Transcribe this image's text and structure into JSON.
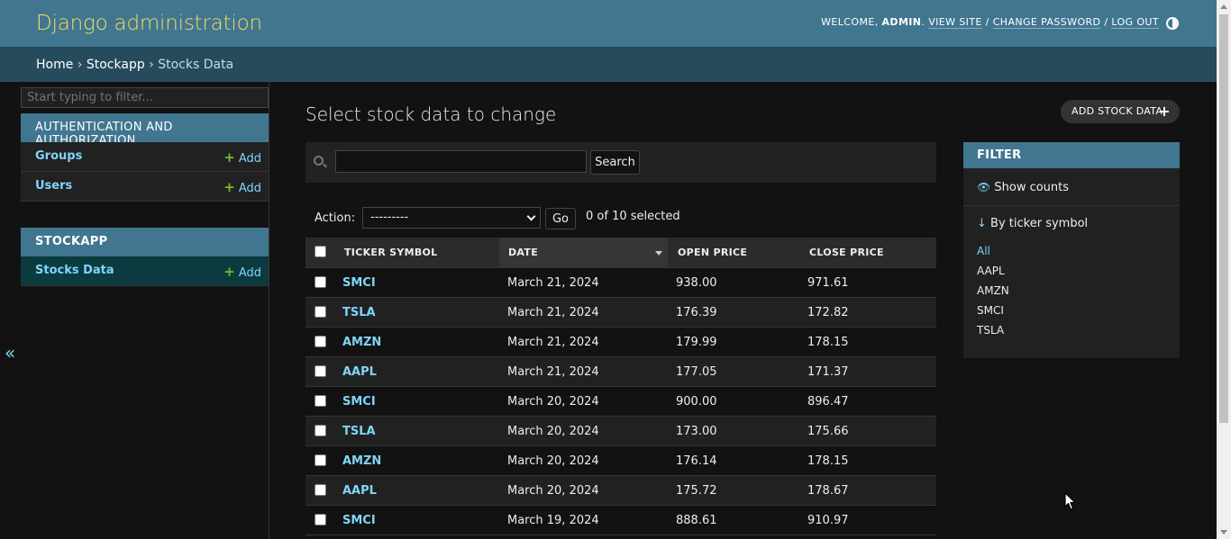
{
  "header": {
    "site_name": "Django administration",
    "welcome": "WELCOME,",
    "username": "ADMIN",
    "view_site": "VIEW SITE",
    "change_password": "CHANGE PASSWORD",
    "log_out": "LOG OUT",
    "theme_icon": "theme-toggle-icon"
  },
  "breadcrumbs": {
    "home": "Home",
    "app": "Stockapp",
    "current": "Stocks Data",
    "separator": "›"
  },
  "sidebar": {
    "filter_placeholder": "Start typing to filter...",
    "apps": [
      {
        "name": "AUTHENTICATION AND AUTHORIZATION",
        "models": [
          {
            "name": "Groups",
            "add": "Add"
          },
          {
            "name": "Users",
            "add": "Add"
          }
        ]
      },
      {
        "name": "STOCKAPP",
        "models": [
          {
            "name": "Stocks Data",
            "add": "Add"
          }
        ]
      }
    ],
    "collapse": "«"
  },
  "content": {
    "title": "Select stock data to change",
    "add_button": "ADD STOCK DATA",
    "search_button": "Search",
    "search_value": "",
    "action_label": "Action:",
    "action_selected": "---------",
    "go_button": "Go",
    "selected_counter": "0 of 10 selected"
  },
  "table": {
    "columns": [
      "TICKER SYMBOL",
      "DATE",
      "OPEN PRICE",
      "CLOSE PRICE"
    ],
    "sorted_column": "DATE",
    "rows": [
      {
        "ticker": "SMCI",
        "date": "March 21, 2024",
        "open": "938.00",
        "close": "971.61"
      },
      {
        "ticker": "TSLA",
        "date": "March 21, 2024",
        "open": "176.39",
        "close": "172.82"
      },
      {
        "ticker": "AMZN",
        "date": "March 21, 2024",
        "open": "179.99",
        "close": "178.15"
      },
      {
        "ticker": "AAPL",
        "date": "March 21, 2024",
        "open": "177.05",
        "close": "171.37"
      },
      {
        "ticker": "SMCI",
        "date": "March 20, 2024",
        "open": "900.00",
        "close": "896.47"
      },
      {
        "ticker": "TSLA",
        "date": "March 20, 2024",
        "open": "173.00",
        "close": "175.66"
      },
      {
        "ticker": "AMZN",
        "date": "March 20, 2024",
        "open": "176.14",
        "close": "178.15"
      },
      {
        "ticker": "AAPL",
        "date": "March 20, 2024",
        "open": "175.72",
        "close": "178.67"
      },
      {
        "ticker": "SMCI",
        "date": "March 19, 2024",
        "open": "888.61",
        "close": "910.97"
      }
    ]
  },
  "filter": {
    "title": "FILTER",
    "show_counts": "Show counts",
    "heading": "By ticker symbol",
    "arrow": "↓",
    "choices": [
      "All",
      "AAPL",
      "AMZN",
      "SMCI",
      "TSLA"
    ],
    "selected": "All"
  },
  "colors": {
    "header": "#417690",
    "breadcrumbs": "#264b5d",
    "brand_text": "#f5dd5d",
    "link": "#81d4fa",
    "add_plus": "#70bf2b",
    "background": "#121212"
  }
}
